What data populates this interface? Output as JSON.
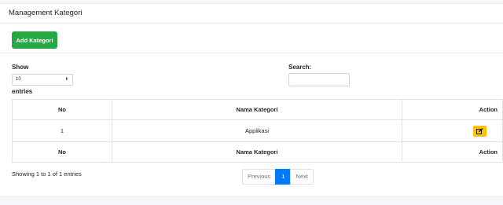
{
  "card": {
    "title": "Management Kategori"
  },
  "toolbar": {
    "add_label": "Add Kategori"
  },
  "length": {
    "show_label": "Show",
    "selected": "10",
    "entries_label": "entries"
  },
  "search": {
    "label": "Search:",
    "value": ""
  },
  "table": {
    "columns": [
      "No",
      "Nama Kategori",
      "Action"
    ],
    "rows": [
      {
        "no": "1",
        "nama": "Applikasi",
        "action_icon": "edit-icon"
      }
    ]
  },
  "info": "Showing 1 to 1 of 1 entries",
  "pagination": {
    "previous": "Previous",
    "current": "1",
    "next": "Next"
  },
  "colors": {
    "add": "#28a745",
    "edit": "#ffc107",
    "active_page": "#007bff"
  }
}
